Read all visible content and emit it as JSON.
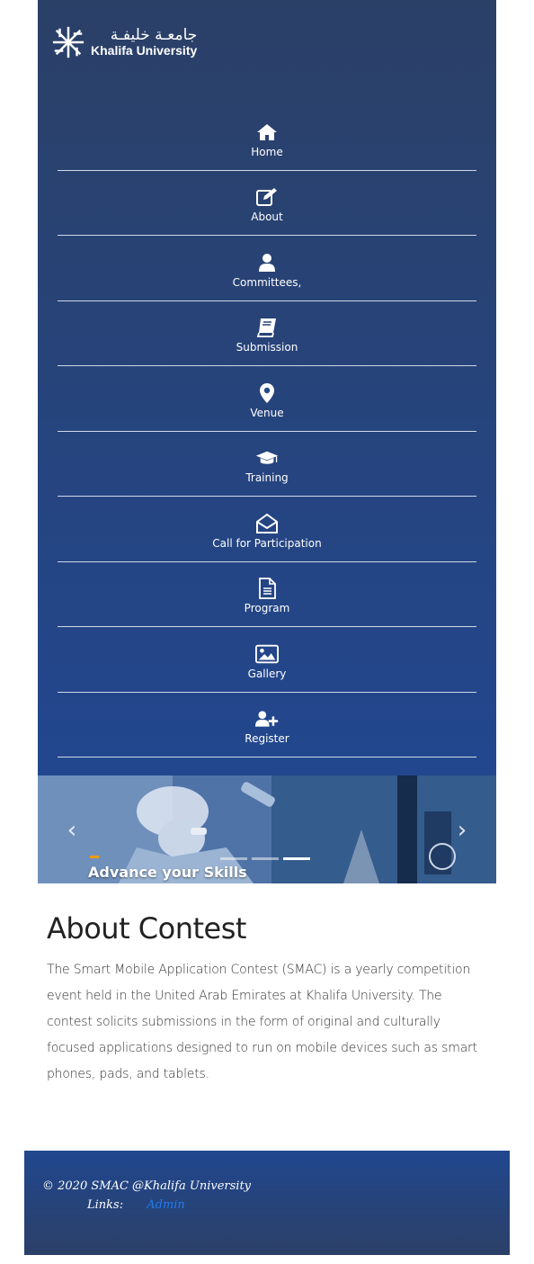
{
  "logo": {
    "arabic": "جامعـة خليفـة",
    "english": "Khalifa University"
  },
  "nav": {
    "items": [
      {
        "label": "Home",
        "icon": "home-icon"
      },
      {
        "label": "About",
        "icon": "edit-icon"
      },
      {
        "label": "Committees,",
        "icon": "user-icon"
      },
      {
        "label": "Submission",
        "icon": "book-icon"
      },
      {
        "label": "Venue",
        "icon": "map-marker-icon"
      },
      {
        "label": "Training",
        "icon": "graduation-cap-icon"
      },
      {
        "label": "Call for Participation",
        "icon": "envelope-open-icon"
      },
      {
        "label": "Program",
        "icon": "file-text-icon"
      },
      {
        "label": "Gallery",
        "icon": "image-icon"
      },
      {
        "label": "Register",
        "icon": "user-plus-icon"
      }
    ]
  },
  "carousel": {
    "caption": "Advance your Skills",
    "prev": "‹",
    "next": "›",
    "slide_count": 3,
    "active_index": 2
  },
  "about": {
    "title": "About Contest",
    "body": "The Smart Mobile Application Contest (SMAC) is a yearly competition event held in the United Arab Emirates at Khalifa University. The contest solicits submissions in the form of original and culturally focused applications designed to run on mobile devices such as smart phones, pads, and tablets."
  },
  "footer": {
    "copyright": "© 2020 SMAC @Khalifa University",
    "links_label": "Links:",
    "admin_link": "Admin"
  },
  "colors": {
    "header_top": "#2b4067",
    "header_bottom": "#22478f",
    "link": "#1e7cf0"
  }
}
